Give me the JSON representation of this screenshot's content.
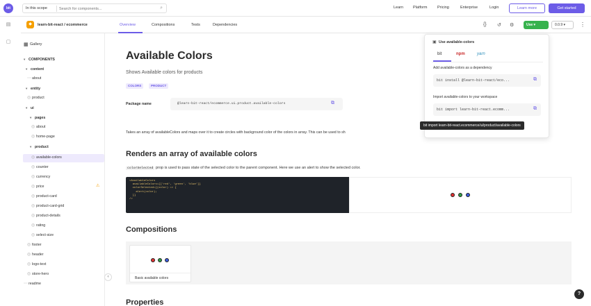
{
  "topbar": {
    "logo_text": "bit",
    "scope_label": "In this scope",
    "search_placeholder": "Search for components...",
    "nav": [
      "Learn",
      "Platform",
      "Pricing",
      "Enterprise",
      "Login"
    ],
    "learn_more": "Learn more",
    "get_started": "Get started"
  },
  "subbar": {
    "component_path": "learn-bit-react / ecommerce",
    "tabs": [
      "Overview",
      "Compositions",
      "Tests",
      "Dependencies"
    ],
    "use_label": "Use ▾",
    "version_label": "0.0.9 ▾"
  },
  "sidebar": {
    "gallery": "Gallery",
    "items": [
      {
        "label": "COMPONENTS",
        "kind": "header"
      },
      {
        "label": "content",
        "kind": "folder"
      },
      {
        "label": "about",
        "kind": "leaf"
      },
      {
        "label": "entity",
        "kind": "folder"
      },
      {
        "label": "product",
        "kind": "leaf"
      },
      {
        "label": "ui",
        "kind": "folder"
      },
      {
        "label": "pages",
        "kind": "folder"
      },
      {
        "label": "about",
        "kind": "leaf"
      },
      {
        "label": "home-page",
        "kind": "leaf"
      },
      {
        "label": "product",
        "kind": "folder"
      },
      {
        "label": "available-colors",
        "kind": "leaf"
      },
      {
        "label": "counter",
        "kind": "leaf"
      },
      {
        "label": "currency",
        "kind": "leaf"
      },
      {
        "label": "price",
        "kind": "leaf"
      },
      {
        "label": "product-card",
        "kind": "leaf"
      },
      {
        "label": "product-card-grid",
        "kind": "leaf"
      },
      {
        "label": "product-details",
        "kind": "leaf"
      },
      {
        "label": "rating",
        "kind": "leaf"
      },
      {
        "label": "select-size",
        "kind": "leaf"
      },
      {
        "label": "footer",
        "kind": "leaf"
      },
      {
        "label": "header",
        "kind": "leaf"
      },
      {
        "label": "logo-text",
        "kind": "leaf"
      },
      {
        "label": "store-hero",
        "kind": "leaf"
      },
      {
        "label": "readme",
        "kind": "leaf"
      }
    ],
    "collapse_icon": "‹"
  },
  "main": {
    "title": "Available Colors",
    "subtitle": "Shows Available colors for products",
    "labels": [
      "COLORS",
      "PRODUCT"
    ],
    "package_label": "Package name",
    "package_name": "@learn-bit-react/ecommerce.ui.product.available-colors",
    "description": "Takes an array of availableColors and maps over it to create circles with background color of the colors in array. This can be used to sh",
    "section_render_title": "Renders an array of available colors",
    "prop_code": "colorSelected",
    "prop_desc": " prop is used to pass state of the selected color to the parent component. Here we use an alert to show the selected color.",
    "code_lines": [
      "<AvailableColors",
      "  availableColors={['red', 'green', 'blue']}",
      "  colorSelected={(color) => {",
      "    alert(color);",
      "  }}",
      "/>"
    ],
    "preview_colors": [
      "#e03131",
      "#2f9e44",
      "#3b5bdb"
    ],
    "compositions_title": "Compositions",
    "composition_card_label": "Basic available colors",
    "properties_title": "Properties"
  },
  "popover": {
    "title": "Use available-colors",
    "tabs": [
      "bit",
      "npm",
      "yarn"
    ],
    "dependency_label": "Add available-colors as a dependency",
    "install_cmd": "bit install @learn-bit-react/eco...",
    "import_label": "Import available-colors to your workspace",
    "import_cmd": "bit import learn-bit-react.ecomm...",
    "tooltip": "bit import learn-bit-react.ecommerce/ui/product/available-colors"
  },
  "help_label": "?",
  "colors": {
    "accent": "#6c5ce7",
    "use_button": "#37b24d",
    "code_bg": "#1f2329"
  }
}
